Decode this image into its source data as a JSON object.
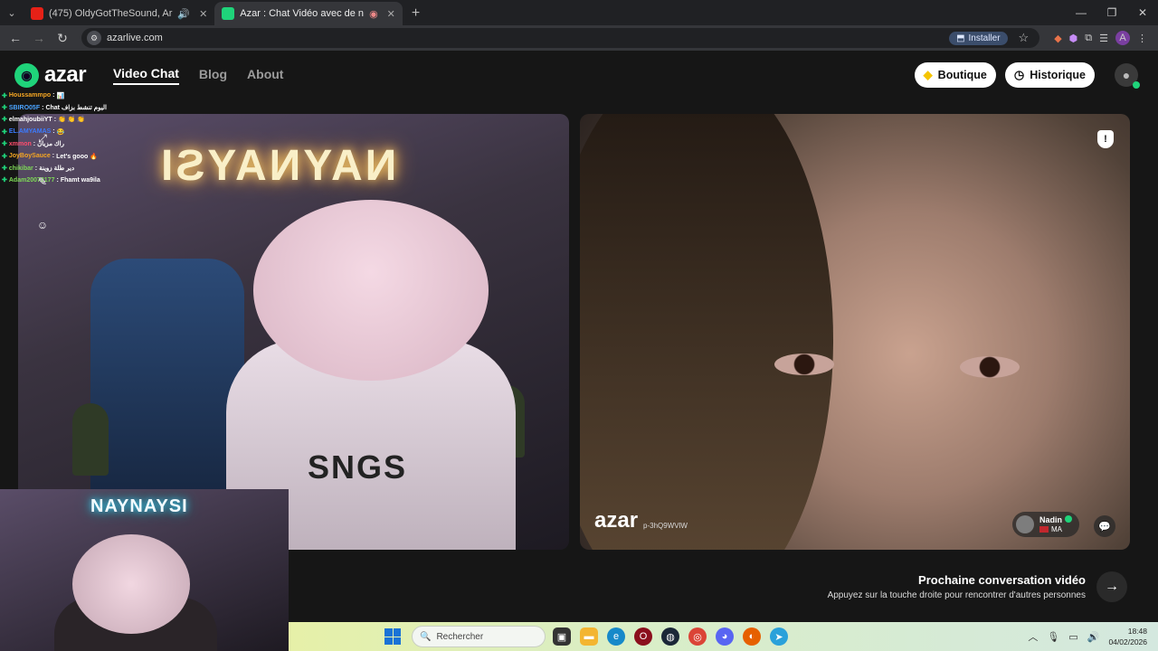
{
  "browser": {
    "tabs": [
      {
        "title": "(475) OldyGotTheSound, Ar",
        "favicon_color": "#e62117",
        "active": false,
        "icon": "speaker-icon"
      },
      {
        "title": "Azar : Chat Vidéo avec de n",
        "favicon_color": "#1fd37a",
        "active": true,
        "icon": "record-icon"
      }
    ],
    "url": "azarlive.com",
    "install_label": "Installer",
    "profile_initial": "A"
  },
  "nav": {
    "brand": "azar",
    "links": [
      "Video Chat",
      "Blog",
      "About"
    ],
    "active_link": "Video Chat",
    "shop_label": "Boutique",
    "history_label": "Historique"
  },
  "stream_chat": [
    {
      "user": "Houssammpo",
      "user_color": "#f5a623",
      "msg": "📊"
    },
    {
      "user": "SBIRO05F",
      "user_color": "#4aa3ff",
      "msg": "Chat اليوم تنشط بزاف"
    },
    {
      "user": "elmahjoubiiYT",
      "user_color": "#ffffff",
      "msg": "👏 👏 👏"
    },
    {
      "user": "EL.AMYAMAS",
      "user_color": "#3b7bff",
      "msg": "😂"
    },
    {
      "user": "xmmon",
      "user_color": "#ff4d6d",
      "msg": "راك مزيان"
    },
    {
      "user": "JoyBoySauce",
      "user_color": "#f5a623",
      "msg": "Let's gooo 🔥"
    },
    {
      "user": "chikibar",
      "user_color": "#7ed957",
      "msg": "دير طلة زوينة"
    },
    {
      "user": "Adam20072177",
      "user_color": "#7ed957",
      "msg": "Fhamt wa9ila"
    }
  ],
  "left_video": {
    "neon_sign": "NAYNAYSI",
    "hoodie_text": "SNGS"
  },
  "right_video": {
    "watermark": "azar",
    "watermark_code": "p-3hQ9WVlW",
    "partner_name": "Nadin",
    "partner_country": "MA"
  },
  "next_conversation": {
    "title": "Prochaine conversation vidéo",
    "subtitle": "Appuyez sur la touche droite pour rencontrer d'autres personnes"
  },
  "webcam": {
    "neon_sign": "NAYNAYSI"
  },
  "taskbar": {
    "search_placeholder": "Rechercher",
    "time": "18:48",
    "date": "04/02/2026"
  }
}
